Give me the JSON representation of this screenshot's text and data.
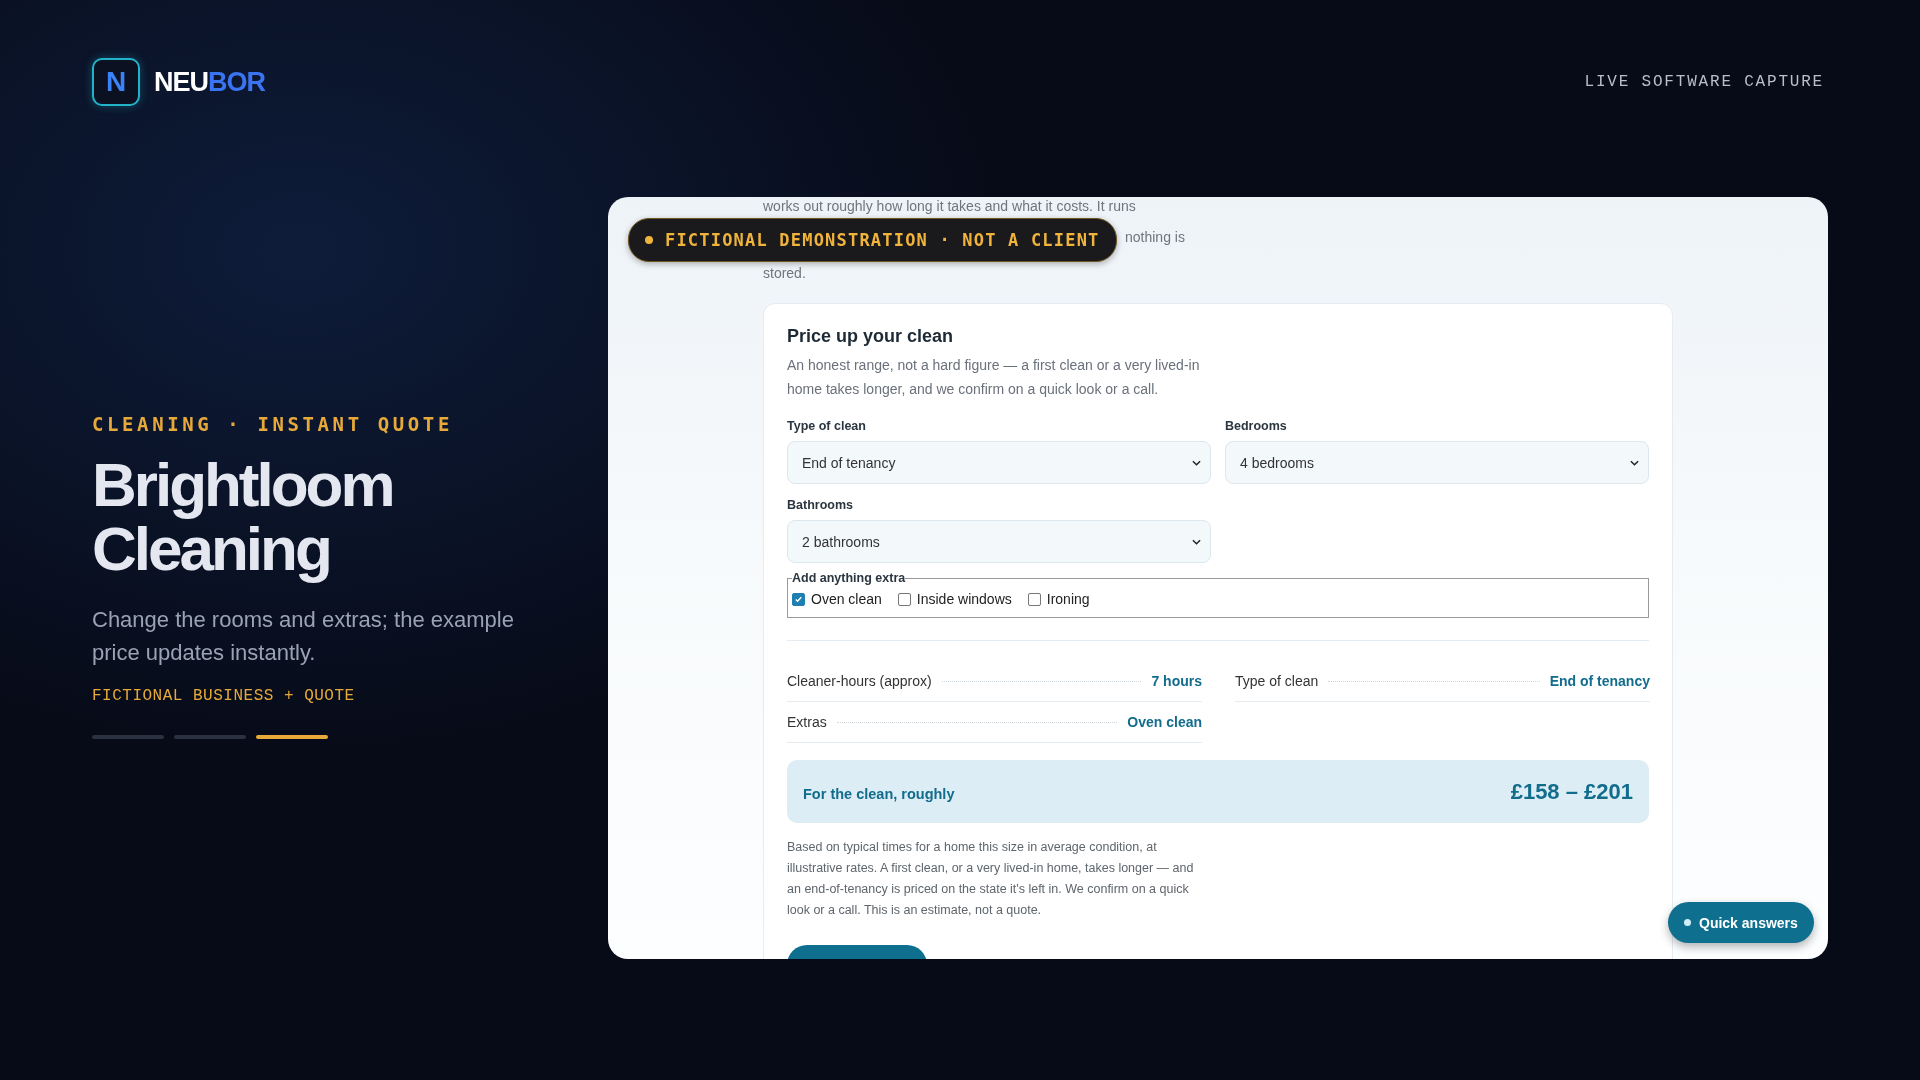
{
  "brand": {
    "mark": "N",
    "name_part_1": "NEU",
    "name_part_2": "BOR"
  },
  "header_tag": "LIVE SOFTWARE CAPTURE",
  "hero": {
    "eyebrow": "CLEANING · INSTANT QUOTE",
    "title_lines": [
      "Brightloom",
      "Cleaning"
    ],
    "subtitle": "Change the rooms and extras; the example price updates instantly.",
    "tag": "FICTIONAL BUSINESS + QUOTE",
    "progress": [
      {
        "selected": false
      },
      {
        "selected": false
      },
      {
        "selected": true
      }
    ]
  },
  "preview": {
    "badge": "FICTIONAL DEMONSTRATION · NOT A CLIENT",
    "intro_lines": [
      "works out roughly how long it takes and what it costs. It runs",
      "nothing is",
      "stored."
    ],
    "form": {
      "title": "Price up your clean",
      "description": "An honest range, not a hard figure — a first clean or a very lived-in home takes longer, and we confirm on a quick look or a call.",
      "fields": [
        {
          "label": "Type of clean",
          "value": "End of tenancy"
        },
        {
          "label": "Bedrooms",
          "value": "4 bedrooms"
        },
        {
          "label": "Bathrooms",
          "value": "2 bathrooms"
        }
      ],
      "extras": {
        "legend": "Add anything extra",
        "options": [
          {
            "label": "Oven clean",
            "checked": true
          },
          {
            "label": "Inside windows",
            "checked": false
          },
          {
            "label": "Ironing",
            "checked": false
          }
        ]
      },
      "summary": [
        {
          "label": "Cleaner-hours (approx)",
          "value": "7 hours"
        },
        {
          "label": "Type of clean",
          "value": "End of tenancy"
        },
        {
          "label": "Extras",
          "value": "Oven clean"
        }
      ],
      "total": {
        "label": "For the clean, roughly",
        "value": "£158 – £201"
      },
      "disclaimer": "Based on typical times for a home this size in average condition, at illustrative rates. A first clean, or a very lived-in home, takes longer — and an end-of-tenancy is priced on the state it's left in. We confirm on a quick look or a call. This is an estimate, not a quote."
    },
    "quick_answers": "Quick answers"
  }
}
